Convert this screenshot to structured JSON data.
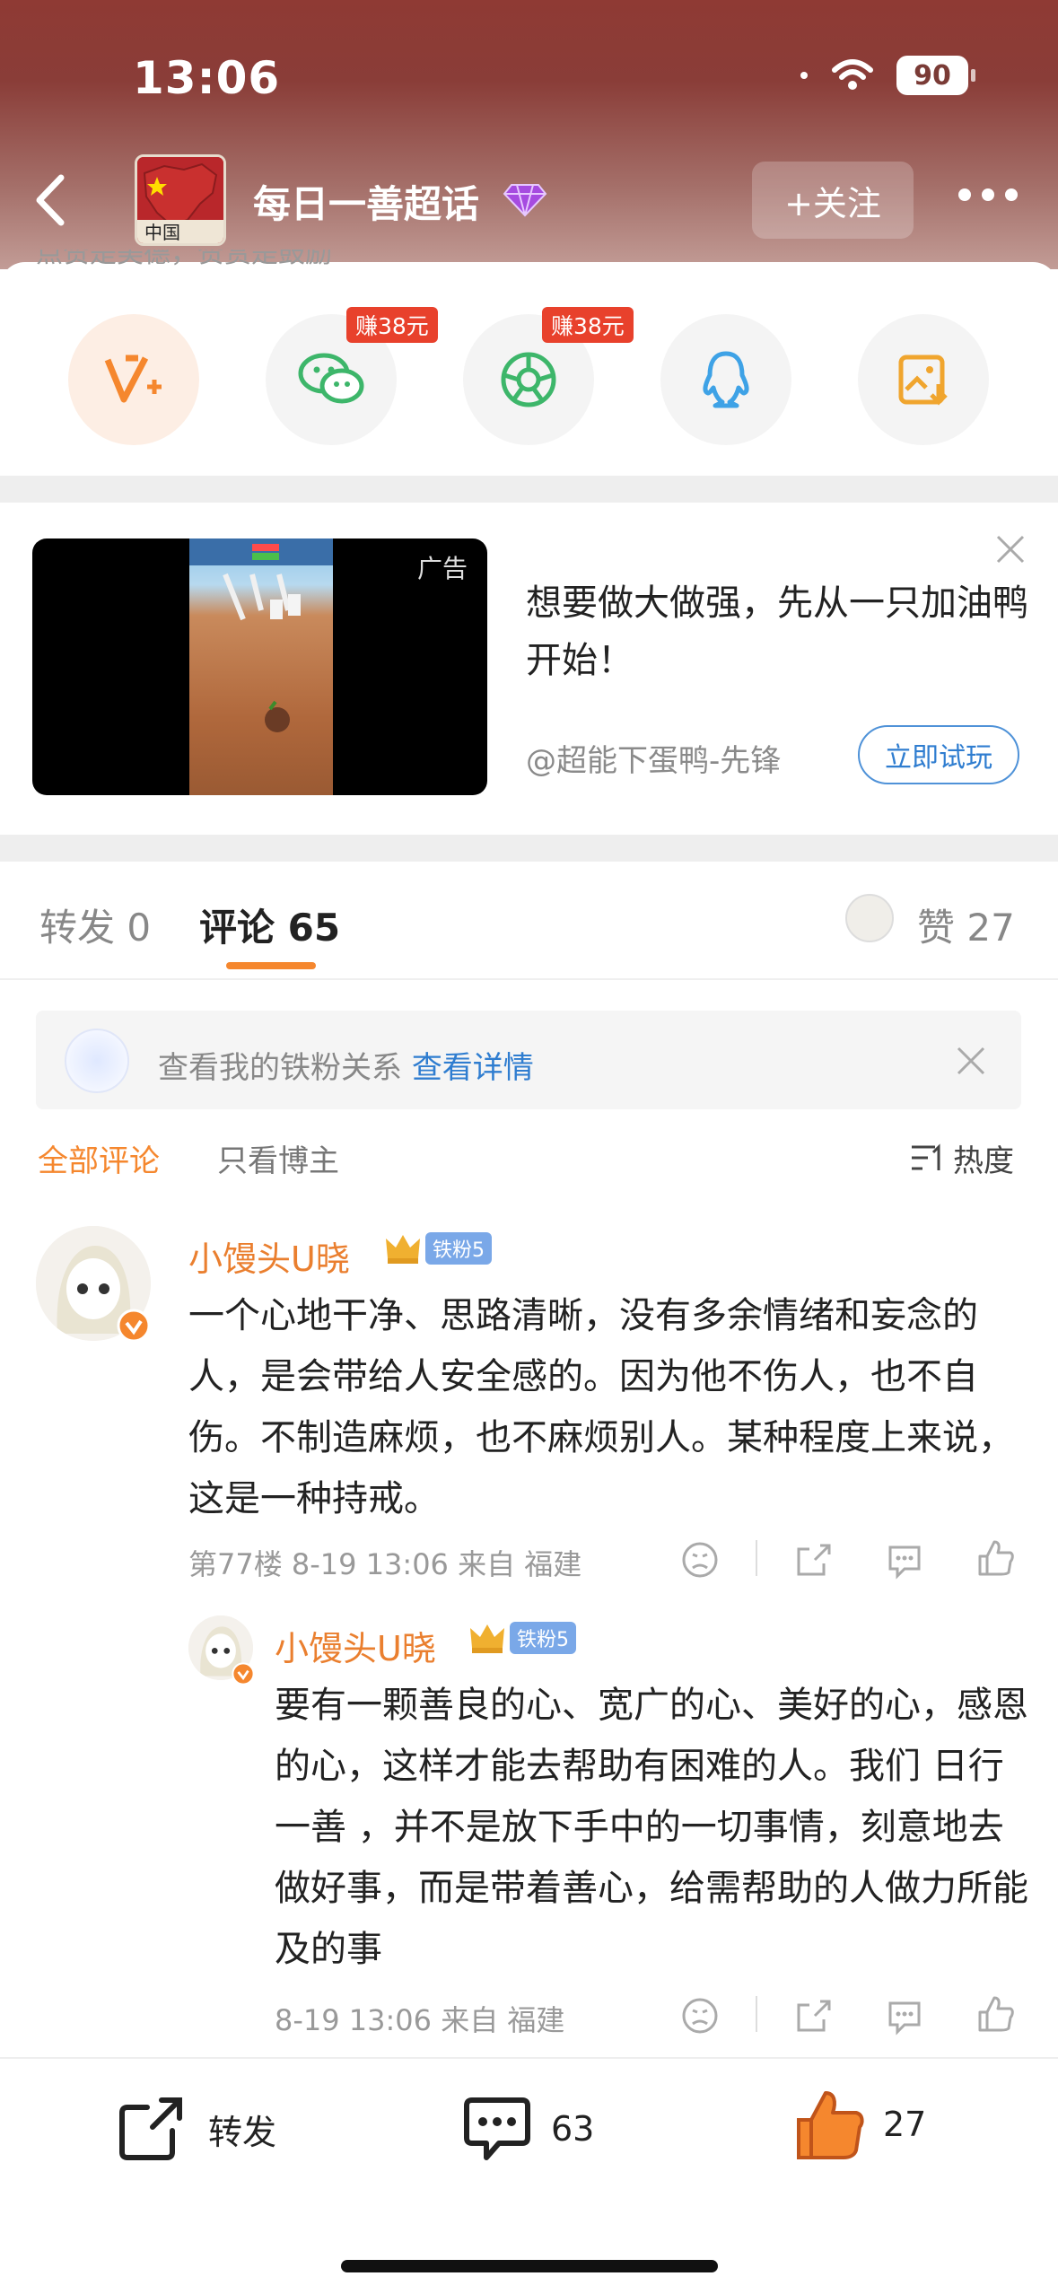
{
  "status": {
    "time": "13:06",
    "battery": "90"
  },
  "header": {
    "topic_title": "每日一善超话",
    "follow_label": "+关注",
    "flag_text": "中国"
  },
  "share": {
    "earn_1": "赚38元",
    "earn_2": "赚38元",
    "partial_text": "点赞是美德，赞赏是鼓励"
  },
  "ad": {
    "label": "广告",
    "text": "想要做大做强，先从一只加油鸭开始！",
    "source": "@超能下蛋鸭-先锋",
    "cta": "立即试玩"
  },
  "tabs": {
    "repost": "转发 0",
    "comments": "评论 65",
    "likes": "赞 27"
  },
  "fan_banner": {
    "text": "查看我的铁粉关系",
    "link": "查看详情"
  },
  "filters": {
    "all": "全部评论",
    "blogger_only": "只看博主",
    "sort": "热度"
  },
  "comments": [
    {
      "user": "小馒头U晓",
      "badge": "铁粉5",
      "text": "一个心地干净、思路清晰，没有多余情绪和妄念的人，是会带给人安全感的。因为他不伤人，也不自伤。不制造麻烦，也不麻烦别人。某种程度上来说，这是一种持戒。",
      "meta": "第77楼  8-19 13:06  来自 福建"
    },
    {
      "user": "小馒头U晓",
      "badge": "铁粉5",
      "text": "要有一颗善良的心、宽广的心、美好的心，感恩的心，这样才能去帮助有困难的人。我们 日行一善 ，并不是放下手中的一切事情，刻意地去做好事，而是带着善心，给需帮助的人做力所能及的事",
      "meta": "8-19 13:06  来自 福建"
    }
  ],
  "bottom_bar": {
    "repost": "转发",
    "comment_count": "63",
    "like_count": "27"
  },
  "colors": {
    "accent": "#f5872e",
    "link": "#2f7dd0",
    "header": "#8f3a34"
  }
}
